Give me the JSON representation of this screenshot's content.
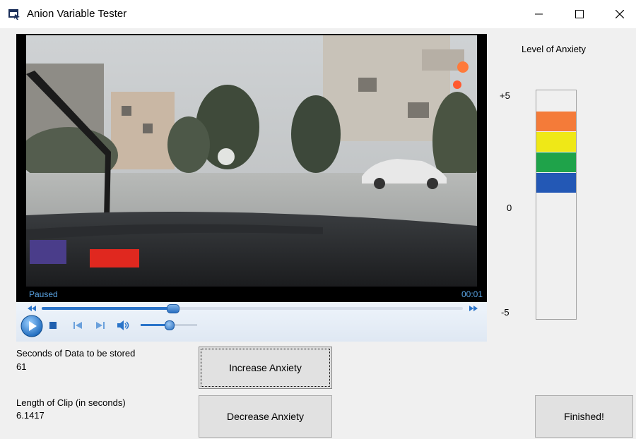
{
  "window": {
    "title": "Anion Variable Tester",
    "app_icon": "app-window-icon",
    "controls": [
      "minimize-icon",
      "maximize-icon",
      "close-icon"
    ]
  },
  "player": {
    "status": "Paused",
    "time": "00:01",
    "seek_progress": 0.31,
    "volume_level": 0.5,
    "controls": [
      "rewind-icon",
      "fast-forward-icon",
      "play-icon",
      "stop-icon",
      "previous-icon",
      "next-icon",
      "volume-icon"
    ],
    "accent_color": "#2a74c9"
  },
  "data": {
    "seconds_label": "Seconds of Data to be stored",
    "seconds_value": "61",
    "clip_label": "Length of Clip (in seconds)",
    "clip_value": "6.1417"
  },
  "buttons": {
    "increase": "Increase Anxiety",
    "decrease": "Decrease Anxiety",
    "finished": "Finished!"
  },
  "meter": {
    "title": "Level of Anxiety",
    "ticks": {
      "top": "+5",
      "middle": "0",
      "bottom": "-5"
    },
    "segments": [
      {
        "color": "#f47b39"
      },
      {
        "color": "#efe817"
      },
      {
        "color": "#1fa34a"
      },
      {
        "color": "#2358b5"
      }
    ]
  }
}
